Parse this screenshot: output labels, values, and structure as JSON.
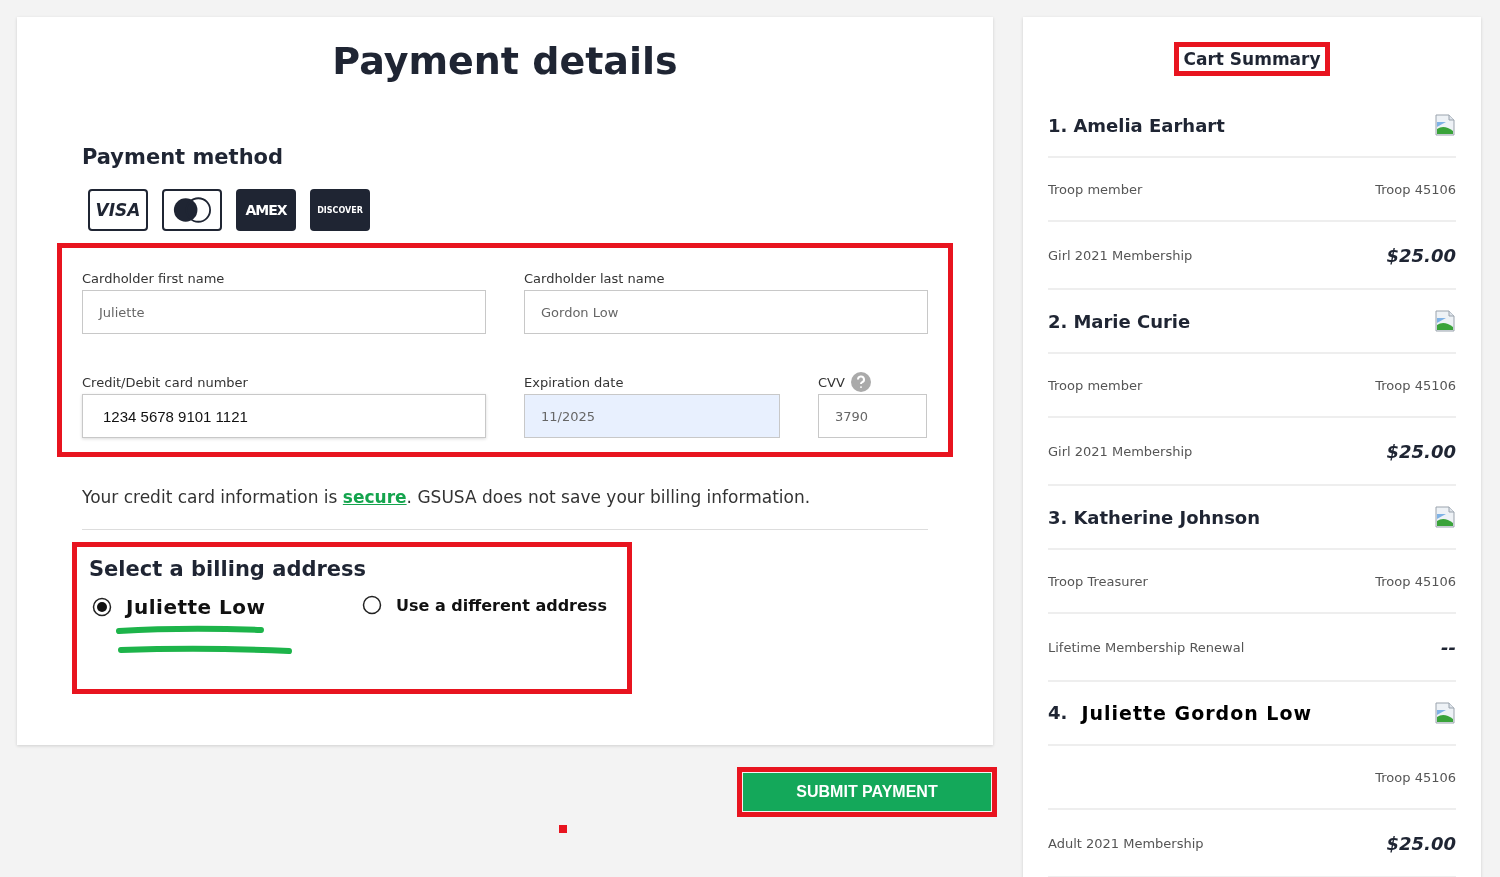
{
  "payment": {
    "title": "Payment details",
    "method_heading": "Payment method",
    "cards": [
      {
        "kind": "visa",
        "label": "VISA"
      },
      {
        "kind": "mastercard"
      },
      {
        "kind": "amex",
        "label": "AMEX"
      },
      {
        "kind": "discover",
        "label": "DISCOVER"
      }
    ],
    "card_fields_highlighted": true,
    "fields": [
      {
        "kind": "name",
        "label": "Cardholder first name",
        "value": "Juliette",
        "autofilled": false
      },
      {
        "kind": "name",
        "label": "Cardholder last name",
        "value": "Gordon Low",
        "autofilled": false
      },
      {
        "kind": "card",
        "label": "Credit/Debit card number",
        "value": "1234 5678 9101 1121",
        "autofilled": false
      },
      {
        "kind": "date",
        "label": "Expiration date",
        "value": "11/2025",
        "autofilled": true
      },
      {
        "kind": "cvv",
        "label": "CVV",
        "value": "3790",
        "autofilled": false
      }
    ],
    "notice_before": "Your credit card information is ",
    "notice_link": "secure",
    "notice_after": ". GSUSA does not save your billing information.",
    "billing": {
      "heading": "Select a billing address",
      "highlighted": true,
      "options": [
        {
          "label": "Juliette Low",
          "selected": true,
          "redacted": true
        },
        {
          "label": "Use a different address",
          "selected": false,
          "redacted": false
        }
      ]
    }
  },
  "submit": {
    "label": "SUBMIT PAYMENT",
    "highlighted": true
  },
  "cart": {
    "title": "Cart Summary",
    "highlighted": true,
    "items": [
      {
        "kind": "standard",
        "number": "1.",
        "name": "Amelia Earhart",
        "rows": [
          {
            "kind": "role",
            "label": "Troop member",
            "value": "Troop 45106"
          },
          {
            "kind": "price",
            "label": "Girl 2021 Membership",
            "value": "$25.00"
          }
        ]
      },
      {
        "kind": "standard",
        "number": "2.",
        "name": "Marie Curie",
        "rows": [
          {
            "kind": "role",
            "label": "Troop member",
            "value": "Troop 45106"
          },
          {
            "kind": "price",
            "label": "Girl 2021 Membership",
            "value": "$25.00"
          }
        ]
      },
      {
        "kind": "standard",
        "number": "3.",
        "name": "Katherine Johnson",
        "rows": [
          {
            "kind": "role",
            "label": "Troop Treasurer",
            "value": "Troop 45106"
          },
          {
            "kind": "price",
            "label": "Lifetime Membership Renewal",
            "value": "--"
          }
        ]
      },
      {
        "kind": "custom",
        "number": "4.",
        "name": "Juliette Gordon Low",
        "rows": [
          {
            "kind": "role",
            "value": "Troop 45106"
          },
          {
            "kind": "price",
            "label": "Adult 2021 Membership",
            "value": "$25.00"
          }
        ]
      }
    ]
  }
}
